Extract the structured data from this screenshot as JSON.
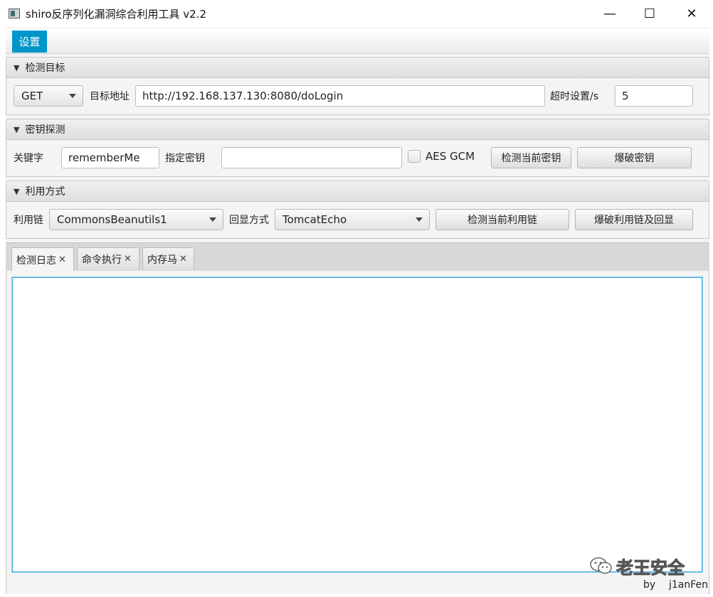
{
  "window": {
    "title": "shiro反序列化漏洞综合利用工具 v2.2",
    "minimize_glyph": "—",
    "maximize_glyph": "☐",
    "close_glyph": "✕"
  },
  "menu": {
    "settings": "设置"
  },
  "target": {
    "header": "检测目标",
    "method": "GET",
    "address_label": "目标地址",
    "address_value": "http://192.168.137.130:8080/doLogin",
    "timeout_label": "超时设置/s",
    "timeout_value": "5"
  },
  "key_detect": {
    "header": "密钥探测",
    "keyword_label": "关键字",
    "keyword_value": "rememberMe",
    "specified_key_label": "指定密钥",
    "specified_key_value": "",
    "aes_gcm_label": "AES GCM",
    "aes_gcm_checked": false,
    "check_current_key": "检测当前密钥",
    "brute_key": "爆破密钥"
  },
  "exploit": {
    "header": "利用方式",
    "chain_label": "利用链",
    "chain_value": "CommonsBeanutils1",
    "echo_label": "回显方式",
    "echo_value": "TomcatEcho",
    "check_chain": "检测当前利用链",
    "brute_chain": "爆破利用链及回显"
  },
  "tabs": [
    {
      "label": "检测日志",
      "close": "✕",
      "active": true
    },
    {
      "label": "命令执行",
      "close": "✕",
      "active": false
    },
    {
      "label": "内存马",
      "close": "✕",
      "active": false
    }
  ],
  "log": {
    "content": ""
  },
  "footer": {
    "by": "by",
    "author": "j1anFen"
  },
  "watermark": {
    "text": "老王安全"
  },
  "colors": {
    "accent": "#0096c9",
    "focus_border": "#39a6dc"
  },
  "arrow_glyph": "▼"
}
